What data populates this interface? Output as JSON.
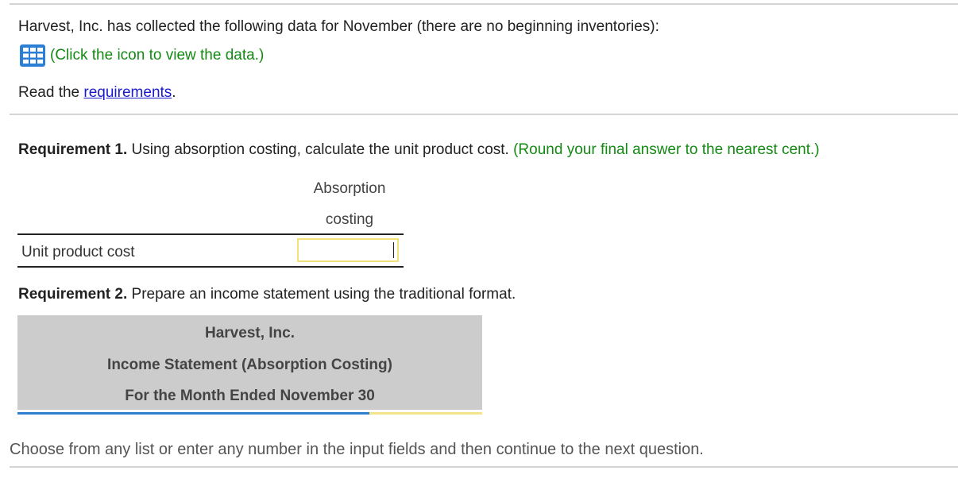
{
  "intro": {
    "text": "Harvest, Inc. has collected the following data for November (there are no beginning inventories):",
    "click_icon_name": "table-grid-icon",
    "click_text": "(Click the icon to view the data.)",
    "read_prefix": "Read the ",
    "read_link": "requirements",
    "read_suffix": "."
  },
  "requirement1": {
    "label": "Requirement 1.",
    "text": " Using absorption costing, calculate the unit product cost.",
    "hint": " (Round your final answer to the nearest cent.)",
    "column_header_line1": "Absorption",
    "column_header_line2": "costing",
    "row_label": "Unit product cost",
    "input_value": ""
  },
  "requirement2": {
    "label": "Requirement 2.",
    "text": " Prepare an income statement using the traditional format.",
    "statement_company": "Harvest, Inc.",
    "statement_title": "Income Statement (Absorption Costing)",
    "statement_period": "For the Month Ended November 30"
  },
  "footer": {
    "text": "Choose from any list or enter any number in the input fields and then continue to the next question."
  },
  "colors": {
    "accent_green": "#138a13",
    "link_blue": "#1a1acc",
    "icon_blue": "#2b7fd4",
    "header_gray": "#cccccc",
    "input_border": "#f2e07a"
  }
}
